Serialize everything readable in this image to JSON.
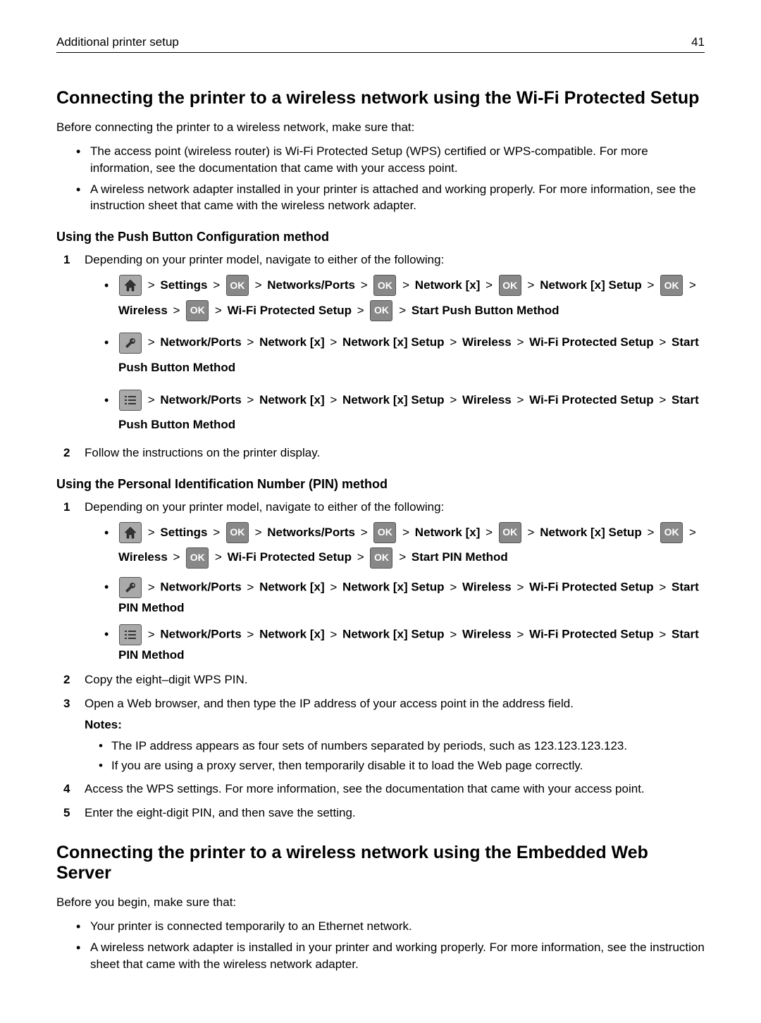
{
  "header": {
    "title": "Additional printer setup",
    "page": "41"
  },
  "section1": {
    "title": "Connecting the printer to a wireless network using the Wi‑Fi Protected Setup",
    "intro": "Before connecting the printer to a wireless network, make sure that:",
    "intro_bullets": [
      "The access point (wireless router) is Wi‑Fi Protected Setup (WPS) certified or WPS‑compatible. For more information, see the documentation that came with your access point.",
      "A wireless network adapter installed in your printer is attached and working properly. For more information, see the instruction sheet that came with the wireless network adapter."
    ],
    "sub1": {
      "title": "Using the Push Button Configuration method",
      "step1": "Depending on your printer model, navigate to either of the following:",
      "path1": {
        "settings": "Settings",
        "np": "Networks/Ports",
        "nx": "Network [x]",
        "nxs": "Network [x] Setup",
        "wl": "Wireless",
        "wps": "Wi‑Fi Protected Setup",
        "start": "Start Push Button Method"
      },
      "path2": {
        "np": "Network/Ports",
        "nx": "Network [x]",
        "nxs": "Network [x] Setup",
        "wl": "Wireless",
        "wps": "Wi‑Fi Protected Setup",
        "start": "Start Push Button Method"
      },
      "path3": {
        "np": "Network/Ports",
        "nx": "Network [x]",
        "nxs": "Network [x] Setup",
        "wl": "Wireless",
        "wps": "Wi‑Fi Protected Setup",
        "start": "Start Push Button Method"
      },
      "step2": "Follow the instructions on the printer display."
    },
    "sub2": {
      "title": "Using the Personal Identification Number (PIN) method",
      "step1": "Depending on your printer model, navigate to either of the following:",
      "path1": {
        "settings": "Settings",
        "np": "Networks/Ports",
        "nx": "Network [x]",
        "nxs": "Network [x] Setup",
        "wl": "Wireless",
        "wps": "Wi‑Fi Protected Setup",
        "start": "Start PIN Method"
      },
      "path2": {
        "np": "Network/Ports",
        "nx": "Network [x]",
        "nxs": "Network [x] Setup",
        "wl": "Wireless",
        "wps": "Wi‑Fi Protected Setup",
        "start": "Start PIN Method"
      },
      "path3": {
        "np": "Network/Ports",
        "nx": "Network [x]",
        "nxs": "Network [x] Setup",
        "wl": "Wireless",
        "wps": "Wi‑Fi Protected Setup",
        "start": "Start PIN Method"
      },
      "step2": "Copy the eight–digit WPS PIN.",
      "step3": "Open a Web browser, and then type the IP address of your access point in the address field.",
      "notes_label": "Notes:",
      "notes": [
        "The IP address appears as four sets of numbers separated by periods, such as 123.123.123.123.",
        "If you are using a proxy server, then temporarily disable it to load the Web page correctly."
      ],
      "step4": "Access the WPS settings. For more information, see the documentation that came with your access point.",
      "step5": "Enter the eight‑digit PIN, and then save the setting."
    }
  },
  "section2": {
    "title": "Connecting the printer to a wireless network using the Embedded Web Server",
    "intro": "Before you begin, make sure that:",
    "bullets": [
      "Your printer is connected temporarily to an Ethernet network.",
      "A wireless network adapter is installed in your printer and working properly. For more information, see the instruction sheet that came with the wireless network adapter."
    ]
  },
  "gt": ">"
}
